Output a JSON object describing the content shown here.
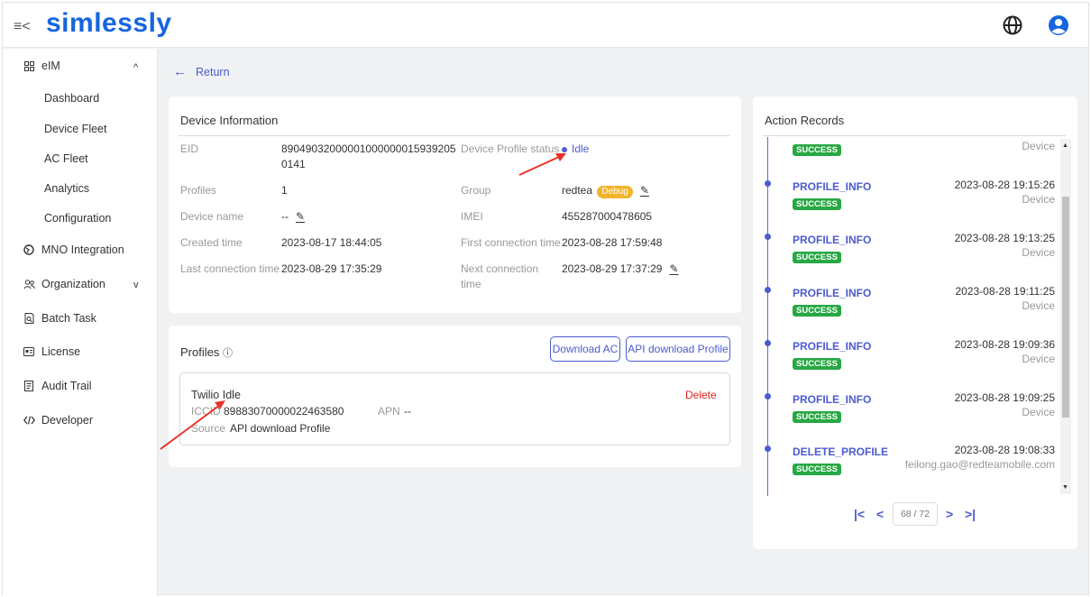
{
  "app": {
    "logo": "simlessly",
    "menu_toggle": "≡<"
  },
  "sidebar": {
    "eim": {
      "label": "eIM",
      "chevron": "^"
    },
    "eim_items": [
      "Dashboard",
      "Device Fleet",
      "AC Fleet",
      "Analytics",
      "Configuration"
    ],
    "mno": "MNO Integration",
    "organization": {
      "label": "Organization",
      "chevron": "v"
    },
    "batch": "Batch Task",
    "license": "License",
    "audit": "Audit Trail",
    "developer": "Developer"
  },
  "return_label": "Return",
  "device_info": {
    "title": "Device Information",
    "eid_label": "EID",
    "eid_line1": "89049032000001000000015939205",
    "eid_line2": "0141",
    "status_label": "Device Profile status",
    "status_value": "Idle",
    "profiles_label": "Profiles",
    "profiles_value": "1",
    "group_label": "Group",
    "group_value": "redtea",
    "group_badge": "Debug",
    "device_name_label": "Device name",
    "device_name_value": "--",
    "imei_label": "IMEI",
    "imei_value": "455287000478605",
    "created_label": "Created time",
    "created_value": "2023-08-17 18:44:05",
    "first_conn_label": "First connection time",
    "first_conn_value": "2023-08-28 17:59:48",
    "last_conn_label": "Last connection time",
    "last_conn_value": "2023-08-29 17:35:29",
    "next_conn_label_1": "Next connection",
    "next_conn_label_2": "time",
    "next_conn_value": "2023-08-29 17:37:29"
  },
  "profiles": {
    "title": "Profiles",
    "download_ac": "Download AC",
    "api_download": "API download Profile",
    "item": {
      "name": "Twilio",
      "status": "Idle",
      "iccid_label": "ICCID",
      "iccid_value": "89883070000022463580",
      "apn_label": "APN",
      "apn_value": "--",
      "source_label": "Source",
      "source_value": "API download Profile",
      "delete": "Delete"
    }
  },
  "action_records": {
    "title": "Action Records",
    "partial_top": {
      "badge": "SUCCESS",
      "by": "Device"
    },
    "records": [
      {
        "name": "PROFILE_INFO",
        "time": "2023-08-28 19:15:26",
        "by": "Device",
        "badge": "SUCCESS"
      },
      {
        "name": "PROFILE_INFO",
        "time": "2023-08-28 19:13:25",
        "by": "Device",
        "badge": "SUCCESS"
      },
      {
        "name": "PROFILE_INFO",
        "time": "2023-08-28 19:11:25",
        "by": "Device",
        "badge": "SUCCESS"
      },
      {
        "name": "PROFILE_INFO",
        "time": "2023-08-28 19:09:36",
        "by": "Device",
        "badge": "SUCCESS"
      },
      {
        "name": "PROFILE_INFO",
        "time": "2023-08-28 19:09:25",
        "by": "Device",
        "badge": "SUCCESS"
      },
      {
        "name": "DELETE_PROFILE",
        "time": "2023-08-28 19:08:33",
        "by": "feilong.gao@redteamobile.com",
        "badge": "SUCCESS"
      }
    ],
    "pagination": {
      "first": "|<",
      "prev": "<",
      "page": "68 / 72",
      "next": ">",
      "last": ">|"
    }
  },
  "colors": {
    "brand": "#1565e0",
    "accent": "#4b5bd0",
    "success": "#27a844",
    "danger": "#e02020",
    "debug": "#f3b32b",
    "annotation": "#e8322a"
  }
}
